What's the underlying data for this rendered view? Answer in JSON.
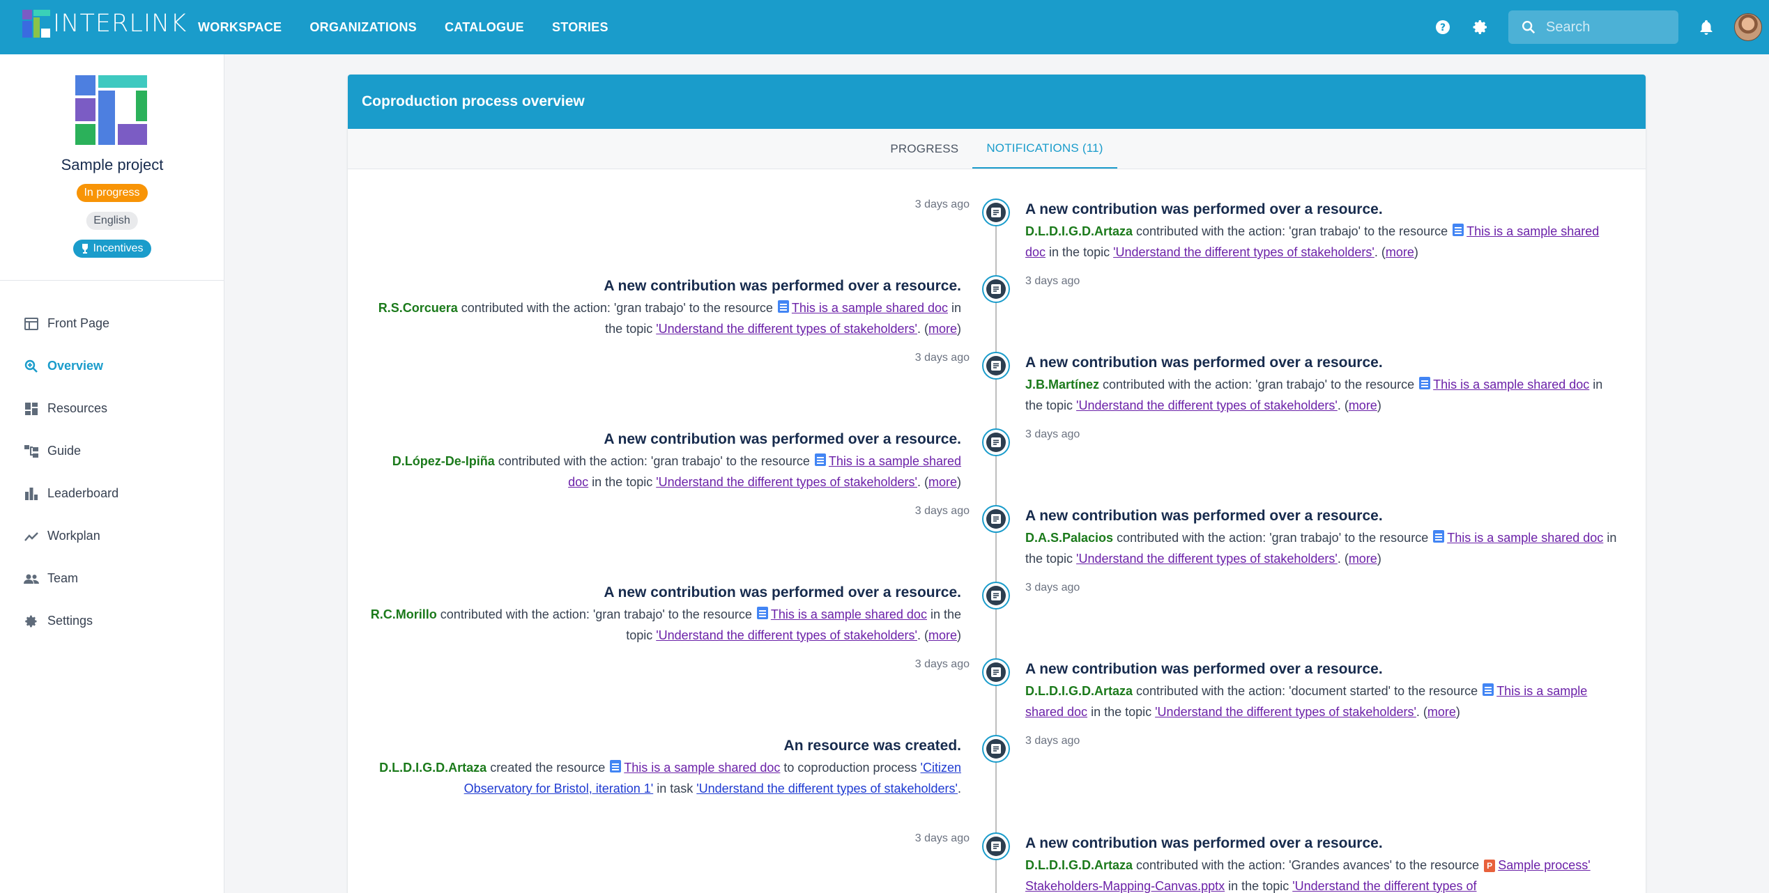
{
  "app": {
    "logo_text": "INTERLINK"
  },
  "nav": {
    "items": [
      "WORKSPACE",
      "ORGANIZATIONS",
      "CATALOGUE",
      "STORIES"
    ]
  },
  "search": {
    "placeholder": "Search"
  },
  "project": {
    "name": "Sample project",
    "status": "In progress",
    "language": "English",
    "incentives": "Incentives"
  },
  "sidebar": {
    "items": [
      {
        "label": "Front Page",
        "icon": "front-page-icon"
      },
      {
        "label": "Overview",
        "icon": "overview-icon",
        "active": true
      },
      {
        "label": "Resources",
        "icon": "resources-icon"
      },
      {
        "label": "Guide",
        "icon": "guide-icon"
      },
      {
        "label": "Leaderboard",
        "icon": "leaderboard-icon"
      },
      {
        "label": "Workplan",
        "icon": "workplan-icon"
      },
      {
        "label": "Team",
        "icon": "team-icon"
      },
      {
        "label": "Settings",
        "icon": "settings-icon"
      }
    ]
  },
  "card": {
    "title": "Coproduction process overview",
    "tabs": [
      "PROGRESS",
      "NOTIFICATIONS (11)"
    ]
  },
  "notifications": [
    {
      "time": "3 days ago",
      "title": "A new contribution was performed over a resource.",
      "user": "D.L.D.I.G.D.Artaza",
      "t1": " contributed with the action: 'gran trabajo' to the resource ",
      "resource": "This is a sample shared doc",
      "t2": " in the topic ",
      "topic": "'Understand the different types of stakeholders'",
      "t3": ". (",
      "more": "more",
      "t4": ")"
    },
    {
      "time": "3 days ago",
      "title": "A new contribution was performed over a resource.",
      "user": "R.S.Corcuera",
      "t1": " contributed with the action: 'gran trabajo' to the resource ",
      "resource": "This is a sample shared doc",
      "t2": " in the topic ",
      "topic": "'Understand the different types of stakeholders'",
      "t3": ". (",
      "more": "more",
      "t4": ")"
    },
    {
      "time": "3 days ago",
      "title": "A new contribution was performed over a resource.",
      "user": "J.B.Martínez",
      "t1": " contributed with the action: 'gran trabajo' to the resource ",
      "resource": "This is a sample shared doc",
      "t2": " in the topic ",
      "topic": "'Understand the different types of stakeholders'",
      "t3": ". (",
      "more": "more",
      "t4": ")"
    },
    {
      "time": "3 days ago",
      "title": "A new contribution was performed over a resource.",
      "user": "D.López-De-Ipiña",
      "t1": " contributed with the action: 'gran trabajo' to the resource ",
      "resource": "This is a sample shared doc",
      "t2": " in the topic ",
      "topic": "'Understand the different types of stakeholders'",
      "t3": ". (",
      "more": "more",
      "t4": ")"
    },
    {
      "time": "3 days ago",
      "title": "A new contribution was performed over a resource.",
      "user": "D.A.S.Palacios",
      "t1": " contributed with the action: 'gran trabajo' to the resource ",
      "resource": "This is a sample shared doc",
      "t2": " in the topic ",
      "topic": "'Understand the different types of stakeholders'",
      "t3": ". (",
      "more": "more",
      "t4": ")"
    },
    {
      "time": "3 days ago",
      "title": "A new contribution was performed over a resource.",
      "user": "R.C.Morillo",
      "t1": " contributed with the action: 'gran trabajo' to the resource ",
      "resource": "This is a sample shared doc",
      "t2": " in the topic ",
      "topic": "'Understand the different types of stakeholders'",
      "t3": ". (",
      "more": "more",
      "t4": ")"
    },
    {
      "time": "3 days ago",
      "title": "A new contribution was performed over a resource.",
      "user": "D.L.D.I.G.D.Artaza",
      "t1": " contributed with the action: 'document started' to the resource ",
      "resource": "This is a sample shared doc",
      "t2": " in the topic ",
      "topic": "'Understand the different types of stakeholders'",
      "t3": ". (",
      "more": "more",
      "t4": ")"
    },
    {
      "time": "3 days ago",
      "title": "An resource was created.",
      "user": "D.L.D.I.G.D.Artaza",
      "t1": " created the resource ",
      "resource": "This is a sample shared doc",
      "t2": " to coproduction process ",
      "process": "'Citizen Observatory for Bristol, iteration 1'",
      "t3": " in task ",
      "topic": "'Understand the different types of stakeholders'",
      "t4": "."
    },
    {
      "time": "3 days ago",
      "title": "A new contribution was performed over a resource.",
      "user": "D.L.D.I.G.D.Artaza",
      "t1": " contributed with the action: 'Grandes avances' to the resource ",
      "resource": "Sample process' Stakeholders-Mapping-Canvas.pptx",
      "t2": " in the topic ",
      "topic": "'Understand the different types of"
    }
  ],
  "colors": {
    "brand": "#1a9ccb",
    "status_in_progress": "#f89406",
    "user_name": "#1b7a1b",
    "link_visited": "#6b21a8"
  }
}
